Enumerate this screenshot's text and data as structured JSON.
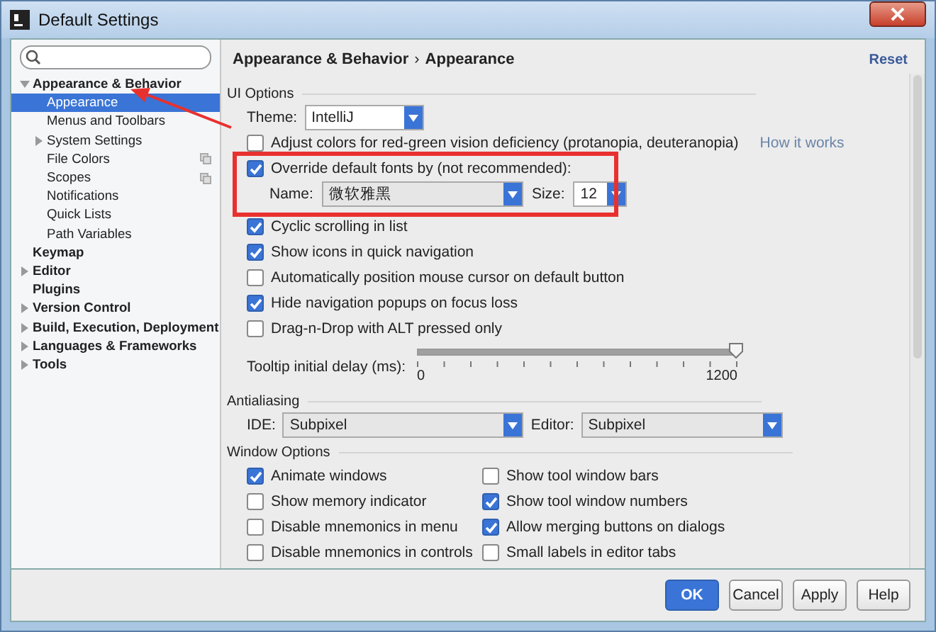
{
  "window": {
    "title": "Default Settings"
  },
  "sidebar": {
    "items": [
      {
        "label": "Appearance & Behavior",
        "expanded": true,
        "selected": false,
        "children": [
          {
            "label": "Appearance",
            "selected": true
          },
          {
            "label": "Menus and Toolbars",
            "selected": false
          },
          {
            "label": "System Settings",
            "selected": false,
            "expanded": false
          },
          {
            "label": "File Colors",
            "selected": false,
            "copy_icon": true
          },
          {
            "label": "Scopes",
            "selected": false,
            "copy_icon": true
          },
          {
            "label": "Notifications",
            "selected": false
          },
          {
            "label": "Quick Lists",
            "selected": false
          },
          {
            "label": "Path Variables",
            "selected": false
          }
        ]
      },
      {
        "label": "Keymap",
        "selected": false
      },
      {
        "label": "Editor",
        "expanded": false,
        "selected": false
      },
      {
        "label": "Plugins",
        "selected": false
      },
      {
        "label": "Version Control",
        "expanded": false,
        "selected": false
      },
      {
        "label": "Build, Execution, Deployment",
        "expanded": false,
        "selected": false
      },
      {
        "label": "Languages & Frameworks",
        "expanded": false,
        "selected": false
      },
      {
        "label": "Tools",
        "expanded": false,
        "selected": false
      }
    ]
  },
  "breadcrumb": {
    "parent": "Appearance & Behavior",
    "separator": "›",
    "current": "Appearance"
  },
  "reset_link": "Reset",
  "ui_options": {
    "heading": "UI Options",
    "theme": {
      "label": "Theme:",
      "value": "IntelliJ"
    },
    "adjust_colors": {
      "label": "Adjust colors for red-green vision deficiency (protanopia, deuteranopia)",
      "checked": false,
      "link": "How it works"
    },
    "override_fonts": {
      "label": "Override default fonts by (not recommended):",
      "checked": true,
      "name_label": "Name:",
      "name_value": "微软雅黑",
      "size_label": "Size:",
      "size_value": "12"
    },
    "options": [
      {
        "label": "Cyclic scrolling in list",
        "checked": true
      },
      {
        "label": "Show icons in quick navigation",
        "checked": true
      },
      {
        "label": "Automatically position mouse cursor on default button",
        "checked": false
      },
      {
        "label": "Hide navigation popups on focus loss",
        "checked": true
      },
      {
        "label": "Drag-n-Drop with ALT pressed only",
        "checked": false
      }
    ],
    "tooltip_delay": {
      "label": "Tooltip initial delay (ms):",
      "level": 1.0,
      "min_label": "0",
      "max_label": "1200"
    }
  },
  "antialiasing": {
    "heading": "Antialiasing",
    "ide_label": "IDE:",
    "ide_value": "Subpixel",
    "editor_label": "Editor:",
    "editor_value": "Subpixel"
  },
  "window_options": {
    "heading": "Window Options",
    "options": [
      {
        "label": "Animate windows",
        "checked": true
      },
      {
        "label": "Show tool window bars",
        "checked": false
      },
      {
        "label": "Show memory indicator",
        "checked": false
      },
      {
        "label": "Show tool window numbers",
        "checked": true
      },
      {
        "label": "Disable mnemonics in menu",
        "checked": false
      },
      {
        "label": "Allow merging buttons on dialogs",
        "checked": true
      },
      {
        "label": "Disable mnemonics in controls",
        "checked": false
      },
      {
        "label": "Small labels in editor tabs",
        "checked": false
      }
    ]
  },
  "buttons": [
    {
      "label": "OK",
      "primary": true
    },
    {
      "label": "Cancel",
      "primary": false
    },
    {
      "label": "Apply",
      "primary": false
    },
    {
      "label": "Help",
      "primary": false
    }
  ],
  "annotation": {
    "highlight": true,
    "arrow": true
  }
}
